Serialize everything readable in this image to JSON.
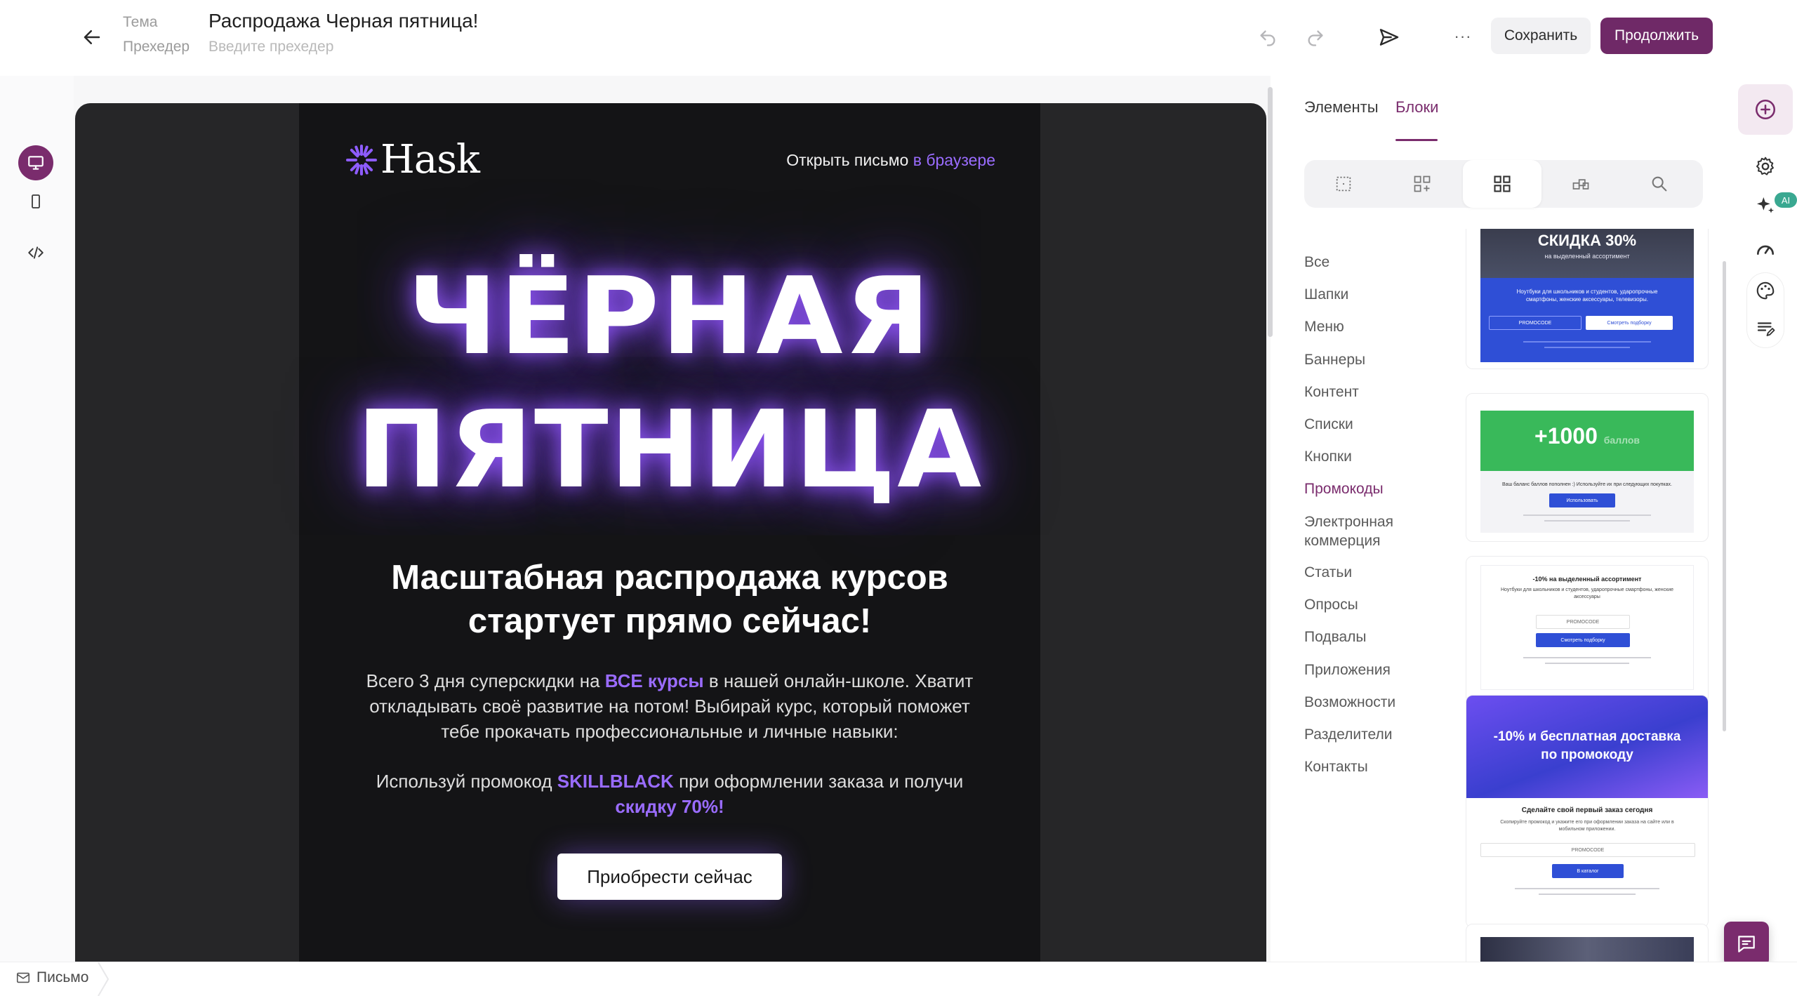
{
  "header": {
    "theme_label": "Тема",
    "subject": "Распродажа Черная пятница!",
    "preheader_label": "Прехедер",
    "preheader_placeholder": "Введите прехедер",
    "more_label": "···",
    "save_label": "Сохранить",
    "continue_label": "Продолжить"
  },
  "email": {
    "logo": "Hask",
    "open_text": "Открыть письмо",
    "open_link": "в браузере",
    "headline_1": "ЧЁРНАЯ",
    "headline_2": "ПЯТНИЦА",
    "subheading": "Масштабная распродажа курсов стартует прямо сейчас!",
    "p1_a": "Всего 3 дня суперскидки на",
    "p1_hl": "ВСЕ курсы",
    "p1_b": "в нашей онлайн-школе. Хватит откладывать своё развитие на потом! Выбирай курс, который поможет тебе прокачать профессиональные и личные навыки:",
    "p2_a": "Используй промокод",
    "p2_code": "SKILLBLACK",
    "p2_b": "при оформлении заказа и получи",
    "p2_hl": "скидку 70%!",
    "cta": "Приобрести сейчас"
  },
  "panel": {
    "tabs": [
      "Элементы",
      "Блоки"
    ],
    "active_tab": "Блоки",
    "categories": [
      "Все",
      "Шапки",
      "Меню",
      "Баннеры",
      "Контент",
      "Списки",
      "Кнопки",
      "Промокоды",
      "Электронная коммерция",
      "Статьи",
      "Опросы",
      "Подвалы",
      "Приложения",
      "Возможности",
      "Разделители",
      "Контакты"
    ],
    "active_category": "Промокоды",
    "thumbs": {
      "t1_title": "СКИДКА 30%",
      "t1_sub": "на выделенный ассортимент",
      "t1_body": "Ноутбуки для школьников и студентов, ударопрочные смартфоны, женские аксессуары, телевизоры.",
      "t1_code": "PROMOCODE",
      "t1_btn": "Смотреть подборку",
      "t2_title": "+1000",
      "t2_sub": "баллов",
      "t2_body": "Ваш баланс баллов пополнен :) Используйте их при следующих покупках.",
      "t2_btn": "Использовать",
      "t3_title": "-10% на выделенный ассортимент",
      "t3_body": "Ноутбуки для школьников и студентов, ударопрочные смартфоны, женские аксессуары",
      "t3_code": "PROMOCODE",
      "t3_btn": "Смотреть подборку",
      "t4_title": "-10% и бесплатная доставка по промокоду",
      "t4_heading": "Сделайте свой первый заказ сегодня",
      "t4_body": "Скопируйте промокод и укажите его при оформлении заказа на сайте или в мобильном приложении.",
      "t4_code": "PROMOCODE",
      "t4_btn": "В каталог"
    }
  },
  "rail": {
    "ai_badge": "AI"
  },
  "footer": {
    "breadcrumb": "Письмо"
  },
  "colors": {
    "brand": "#7a2c6d",
    "continue_button": "#6f2967",
    "email_bg": "#141416",
    "email_accent": "#9a6cff",
    "thumb_blue": "#2f4fd6",
    "thumb_green": "#39b95a"
  }
}
